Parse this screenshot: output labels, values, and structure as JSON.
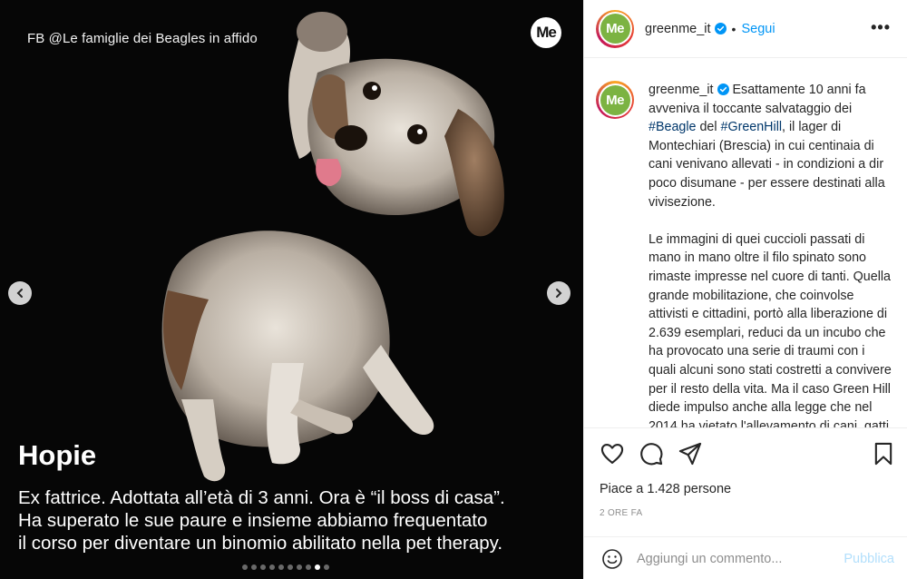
{
  "media": {
    "credit": "FB @Le famiglie dei Beagles in affido",
    "badge": "Me",
    "dog_name": "Hopie",
    "caption_lines": [
      "Ex fattrice. Adottata all’età di 3 anni. Ora è “il boss di casa”.",
      "Ha superato le sue paure e insieme abbiamo frequentato",
      "il corso per diventare un binomio abilitato nella pet therapy."
    ],
    "carousel": {
      "total": 10,
      "active_index": 8
    }
  },
  "header": {
    "avatar_text": "Me",
    "username": "greenme_it",
    "separator": "•",
    "follow_label": "Segui",
    "more_icon": "more-icon"
  },
  "caption": {
    "username": "greenme_it",
    "p1_a": "Esattamente 10 anni fa avveniva il toccante salvataggio dei ",
    "hashtag1": "#Beagle",
    "p1_b": " del ",
    "hashtag2": "#GreenHill",
    "p1_c": ", il lager di Montechiari (Brescia) in cui centinaia di cani venivano allevati - in condizioni a dir poco disumane - per essere destinati alla vivisezione.",
    "p2": "Le immagini di quei cuccioli passati di mano in mano oltre il filo spinato sono rimaste impresse nel cuore di tanti. Quella grande mobilitazione, che coinvolse attivisti e cittadini, portò alla liberazione di 2.639 esemplari, reduci da un incubo che ha provocato una serie di traumi con i quali alcuni sono stati costretti a convivere per il resto della vita. Ma il caso Green Hill diede impulso anche alla legge che nel 2014 ha vietato l'allevamento di cani, gatti e primati"
  },
  "actions": {
    "likes": "Piace a 1.428 persone",
    "time": "2 ORE FA"
  },
  "comment": {
    "placeholder": "Aggiungi un commento...",
    "publish_label": "Pubblica"
  },
  "colors": {
    "accent": "#0095f6",
    "publish_disabled": "#b2dffc",
    "hashtag": "#00376b",
    "brand_green": "#7cb342"
  }
}
